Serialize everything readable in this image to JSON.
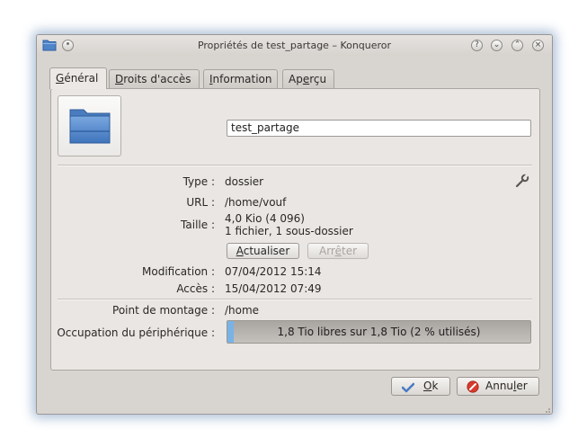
{
  "window": {
    "title": "Propriétés de test_partage – Konqueror",
    "controls": [
      "?",
      "⌄",
      "⌃",
      "×"
    ]
  },
  "tabs": [
    {
      "prefix": "",
      "mnemonic": "G",
      "rest": "énéral",
      "active": true
    },
    {
      "prefix": "",
      "mnemonic": "D",
      "rest": "roits d'accès",
      "active": false
    },
    {
      "prefix": "",
      "mnemonic": "I",
      "rest": "nformation",
      "active": false
    },
    {
      "prefix": "Ap",
      "mnemonic": "e",
      "rest": "rçu",
      "active": false
    }
  ],
  "general": {
    "name_value": "test_partage",
    "type_label": "Type :",
    "type_value": "dossier",
    "url_label": "URL :",
    "url_value": "/home/vouf",
    "size_label": "Taille :",
    "size_value_1": "4,0 Kio (4 096)",
    "size_value_2": "1 fichier, 1 sous-dossier",
    "refresh_mnemonic": "A",
    "refresh_rest": "ctualiser",
    "stop_prefix": "Arr",
    "stop_mnemonic": "ê",
    "stop_rest": "ter",
    "modified_label": "Modification :",
    "modified_value": "07/04/2012 15:14",
    "accessed_label": "Accès :",
    "accessed_value": "15/04/2012 07:49",
    "mount_label": "Point de montage :",
    "mount_value": "/home",
    "usage_label": "Occupation du périphérique :",
    "usage_text": "1,8 Tio libres sur 1,8 Tio (2 % utilisés)",
    "usage_percent": 2
  },
  "buttons": {
    "ok_mnemonic": "O",
    "ok_rest": "k",
    "cancel_prefix": "Annu",
    "cancel_mnemonic": "l",
    "cancel_rest": "er"
  },
  "colors": {
    "folder_blue": "#5b8fd0",
    "usage_fill": "#79b3e6",
    "cancel_red": "#d83a2c",
    "ok_blue": "#4a7bc4"
  }
}
